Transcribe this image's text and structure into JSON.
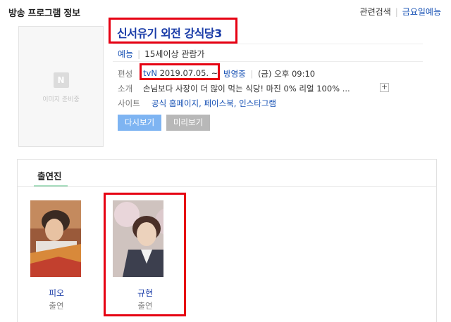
{
  "header": {
    "title": "방송 프로그램 정보",
    "related_search": "관련검색",
    "divider": "|",
    "friday_shows": "금요일예능"
  },
  "poster": {
    "logo_letter": "N",
    "placeholder_text": "이미지 준비중"
  },
  "program": {
    "title": "신서유기 외전 강식당3",
    "genre": "예능",
    "rating": "15세이상 관람가",
    "schedule_label": "편성",
    "channel": "tvN",
    "start_date": "2019.07.05. ~",
    "status": "방영중",
    "airtime": "(금) 오후 09:10",
    "intro_label": "소개",
    "intro_text": "손님보다 사장이 더 많이 먹는 식당! 마진 0% 리얼 100% ...",
    "site_label": "사이트",
    "sites": "공식 홈페이지, 페이스북, 인스타그램"
  },
  "buttons": {
    "watch_again": "다시보기",
    "preview": "미리보기"
  },
  "cast_section": {
    "tab_label": "출연진",
    "members": [
      {
        "name": "피오",
        "role": "출연"
      },
      {
        "name": "규현",
        "role": "출연"
      }
    ]
  },
  "colors": {
    "highlight_red": "#e60012",
    "link_blue": "#1550b4",
    "tab_green": "#0aa34a",
    "watch_button": "#7eb4f2",
    "preview_button": "#b8b8b8"
  }
}
